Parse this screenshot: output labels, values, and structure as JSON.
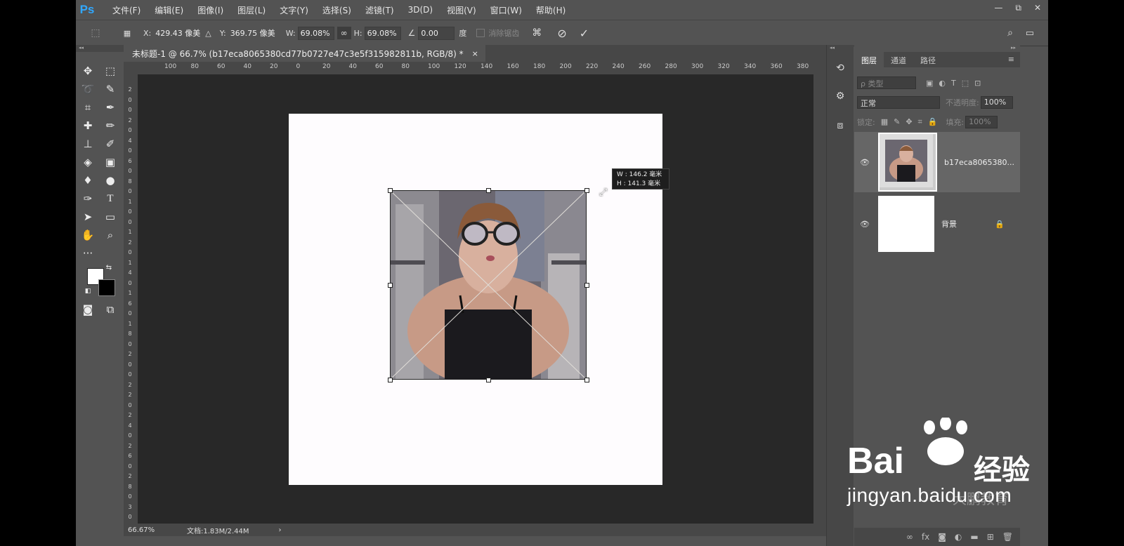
{
  "menubar": {
    "logo": "Ps",
    "items": [
      "文件(F)",
      "编辑(E)",
      "图像(I)",
      "图层(L)",
      "文字(Y)",
      "选择(S)",
      "滤镜(T)",
      "3D(D)",
      "视图(V)",
      "窗口(W)",
      "帮助(H)"
    ],
    "window_controls": [
      "—",
      "⧉",
      "✕"
    ]
  },
  "options": {
    "x_label": "X:",
    "x_value": "429.43 像美",
    "y_label": "Y:",
    "y_value": "369.75 像美",
    "w_label": "W:",
    "w_value": "69.08%",
    "h_label": "H:",
    "h_value": "69.08%",
    "angle_value": "0.00",
    "angle_unit": "度",
    "antialias_label": "消除锯齿"
  },
  "document": {
    "tab_title": "未标题-1 @ 66.7% (b17eca8065380cd77b0727e47c3e5f315982811b, RGB/8) *",
    "tab_close": "×",
    "tooltip_w": "W :  146.2 毫米",
    "tooltip_h": "H :  141.3 毫米"
  },
  "ruler": {
    "h_labels": [
      "100",
      "80",
      "60",
      "40",
      "20",
      "0",
      "20",
      "40",
      "60",
      "80",
      "100",
      "120",
      "140",
      "160",
      "180",
      "200",
      "220",
      "240",
      "260",
      "280",
      "300",
      "320",
      "340",
      "360",
      "380"
    ],
    "v_labels": [
      "2",
      "0",
      "0",
      "2",
      "0",
      "4",
      "0",
      "6",
      "0",
      "8",
      "0",
      "1",
      "0",
      "0",
      "1",
      "2",
      "0",
      "1",
      "4",
      "0",
      "1",
      "6",
      "0",
      "1",
      "8",
      "0",
      "2",
      "0",
      "0",
      "2",
      "2",
      "0",
      "2",
      "4",
      "0",
      "2",
      "6",
      "0",
      "2",
      "8",
      "0",
      "3",
      "0"
    ]
  },
  "status": {
    "zoom": "66.67%",
    "doc_info": "文档:1.83M/2.44M",
    "arrow": "›"
  },
  "layers_panel": {
    "tabs": [
      "图层",
      "通道",
      "路径"
    ],
    "filter_placeholder": "ρ 类型",
    "blend_mode": "正常",
    "opacity_label": "不透明度:",
    "opacity_value": "100%",
    "lock_label": "锁定:",
    "fill_label": "填充:",
    "fill_value": "100%",
    "layers": [
      {
        "name": "b17eca8065380...",
        "visible": true
      },
      {
        "name": "背景",
        "visible": true,
        "locked": true
      }
    ],
    "footer_icons": [
      "link-icon",
      "fx-icon",
      "mask-icon",
      "adjustment-icon",
      "folder-icon",
      "new-layer-icon",
      "trash-icon"
    ]
  },
  "watermark": {
    "brand": "Bai",
    "brand_tail": "经验",
    "url": "jingyan.baidu.com",
    "sub": "大鹏教育"
  },
  "colors": {
    "app_bg": "#535353",
    "panel_dark": "#474747",
    "pasteboard": "#282828",
    "ps_blue": "#31a8ff"
  }
}
